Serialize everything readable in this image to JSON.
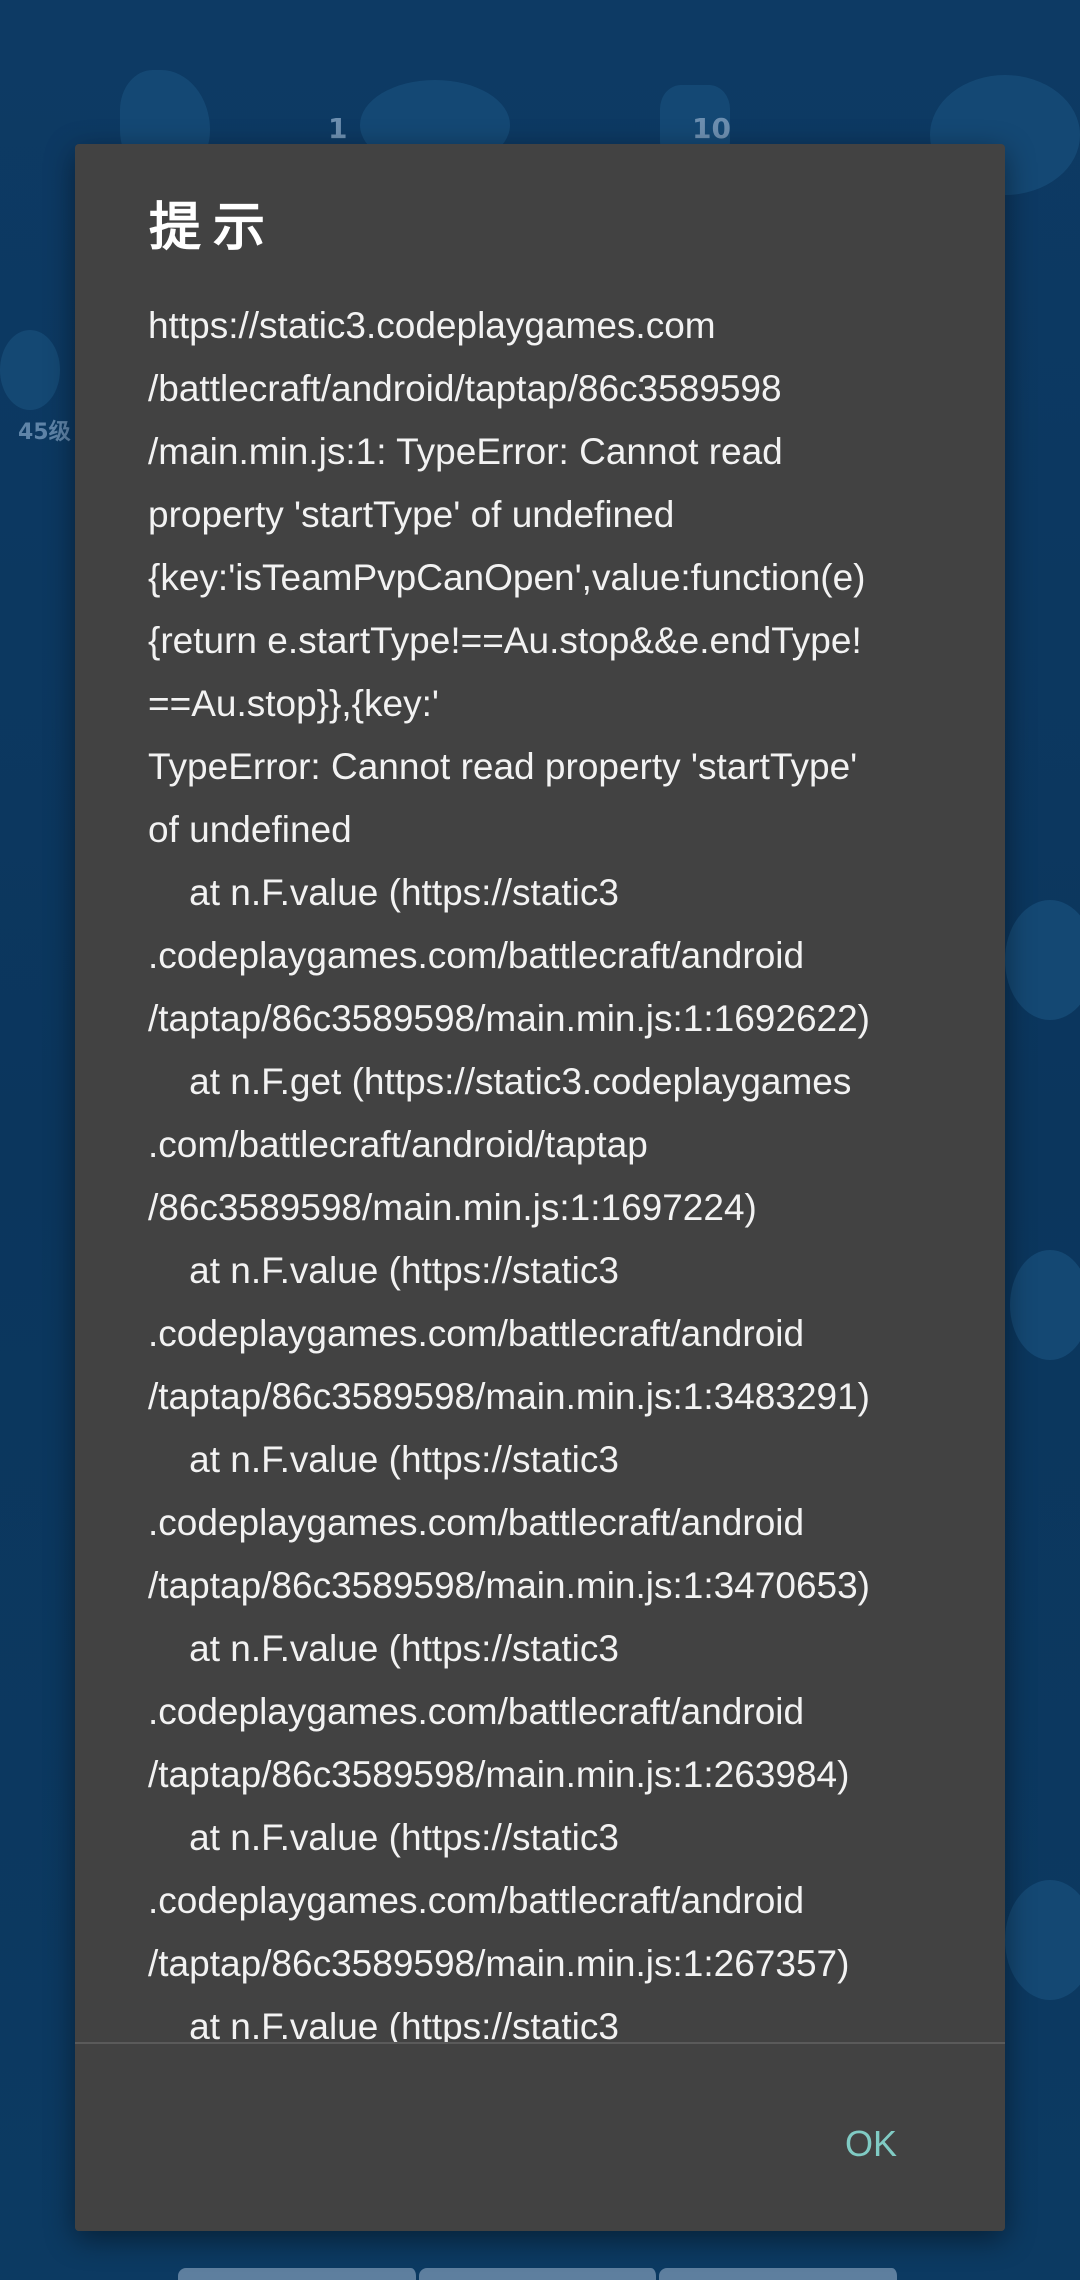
{
  "background": {
    "numbers": [
      "1",
      "10"
    ],
    "level_label": "45级"
  },
  "dialog": {
    "title": "提示",
    "message": "https://static3.codeplaygames.com\n/battlecraft/android/taptap/86c3589598\n/main.min.js:1: TypeError: Cannot read\nproperty 'startType' of undefined\n{key:'isTeamPvpCanOpen',value:function(e)\n{return e.startType!==Au.stop&&e.endType!\n==Au.stop}},{key:'\nTypeError: Cannot read property 'startType'\nof undefined\n    at n.F.value (https://static3\n.codeplaygames.com/battlecraft/android\n/taptap/86c3589598/main.min.js:1:1692622)\n    at n.F.get (https://static3.codeplaygames\n.com/battlecraft/android/taptap\n/86c3589598/main.min.js:1:1697224)\n    at n.F.value (https://static3\n.codeplaygames.com/battlecraft/android\n/taptap/86c3589598/main.min.js:1:3483291)\n    at n.F.value (https://static3\n.codeplaygames.com/battlecraft/android\n/taptap/86c3589598/main.min.js:1:3470653)\n    at n.F.value (https://static3\n.codeplaygames.com/battlecraft/android\n/taptap/86c3589598/main.min.js:1:263984)\n    at n.F.value (https://static3\n.codeplaygames.com/battlecraft/android\n/taptap/86c3589598/main.min.js:1:267357)\n    at n.F.value (https://static3",
    "ok_label": "OK"
  },
  "colors": {
    "background": "#0e3a63",
    "dialog_surface": "#424242",
    "title_text": "#ffffff",
    "body_text": "#f2f2f2",
    "accent": "#80cbc4"
  }
}
